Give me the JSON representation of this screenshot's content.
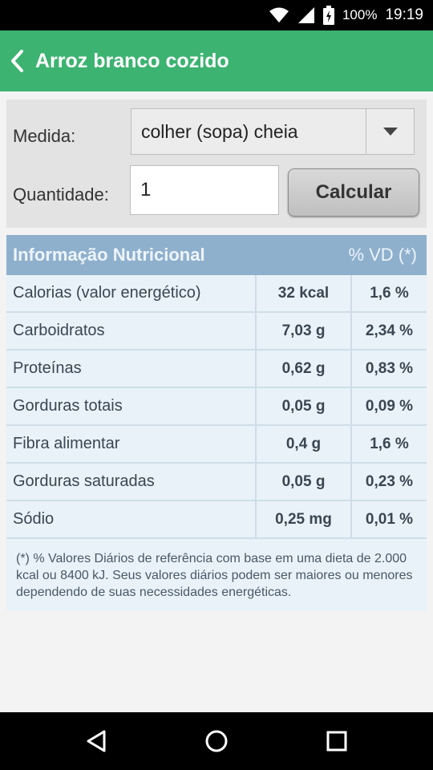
{
  "status_bar": {
    "battery": "100%",
    "time": "19:19",
    "icons": [
      "wifi-icon",
      "cell-signal-icon",
      "battery-icon"
    ]
  },
  "app_bar": {
    "title": "Arroz branco cozido",
    "back_icon": "chevron-left-icon",
    "color": "#3cb371"
  },
  "form": {
    "medida_label": "Medida:",
    "medida_value": "colher (sopa) cheia",
    "quantidade_label": "Quantidade:",
    "quantidade_value": "1",
    "calc_label": "Calcular"
  },
  "nutrition": {
    "header_title": "Informação Nutricional",
    "header_vd": "% VD (*)",
    "rows": [
      {
        "name": "Calorias (valor energético)",
        "amount": "32 kcal",
        "vd": "1,6 %"
      },
      {
        "name": "Carboidratos",
        "amount": "7,03 g",
        "vd": "2,34 %"
      },
      {
        "name": "Proteínas",
        "amount": "0,62 g",
        "vd": "0,83 %"
      },
      {
        "name": "Gorduras totais",
        "amount": "0,05 g",
        "vd": "0,09 %"
      },
      {
        "name": "Fibra alimentar",
        "amount": "0,4 g",
        "vd": "1,6 %"
      },
      {
        "name": "Gorduras saturadas",
        "amount": "0,05 g",
        "vd": "0,23 %"
      },
      {
        "name": "Sódio",
        "amount": "0,25 mg",
        "vd": "0,01 %"
      }
    ],
    "footnote": "(*) % Valores Diários de referência com base em uma dieta de 2.000 kcal ou 8400 kJ. Seus valores diários podem ser maiores ou menores dependendo de suas necessidades energéticas."
  },
  "nav_bar": {
    "icons": [
      "back-triangle-icon",
      "home-circle-icon",
      "recents-square-icon"
    ]
  }
}
